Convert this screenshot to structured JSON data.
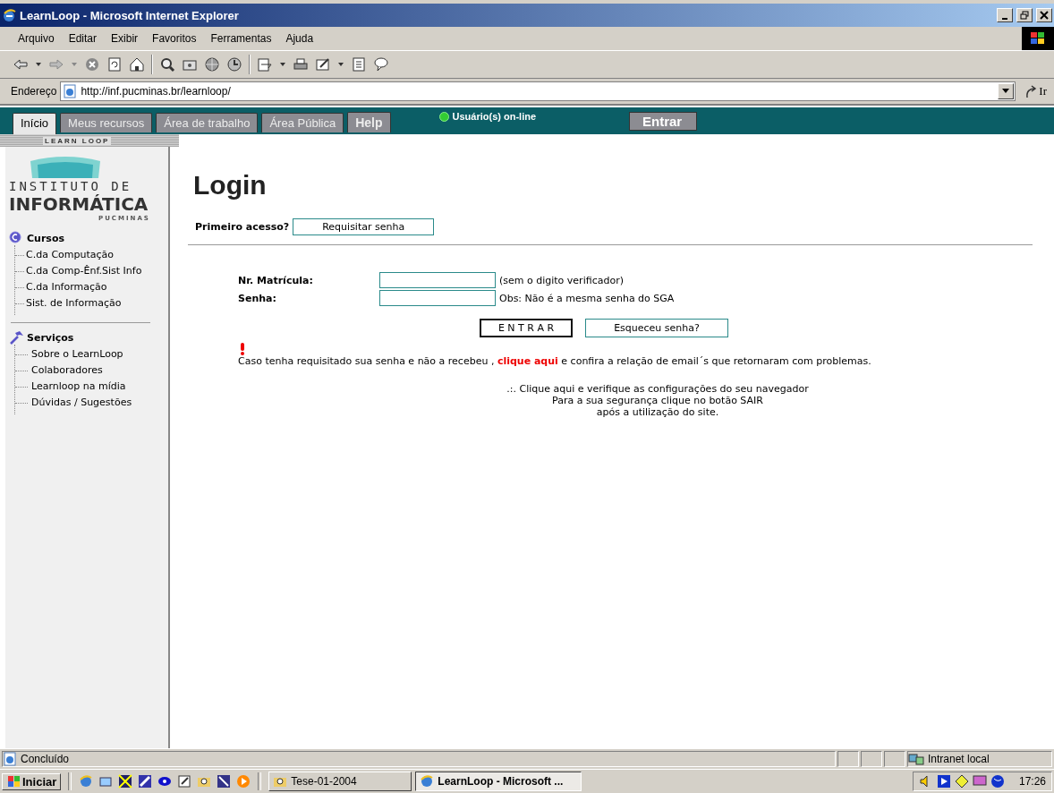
{
  "window": {
    "title": "LearnLoop - Microsoft Internet Explorer"
  },
  "menu": [
    "Arquivo",
    "Editar",
    "Exibir",
    "Favoritos",
    "Ferramentas",
    "Ajuda"
  ],
  "address": {
    "label": "Endereço",
    "url": "http://inf.pucminas.br/learnloop/",
    "go": "Ir"
  },
  "site_nav": {
    "tabs": [
      {
        "label": "Início",
        "selected": true
      },
      {
        "label": "Meus recursos",
        "selected": false
      },
      {
        "label": "Área de trabalho",
        "selected": false
      },
      {
        "label": "Área Pública",
        "selected": false
      },
      {
        "label": "Help",
        "selected": false
      }
    ],
    "online": "Usuário(s) on-line",
    "enter": "Entrar",
    "strip": "LEARN LOOP"
  },
  "sidebar": {
    "logo": [
      "INSTITUTO DE",
      "INFORMÁTICA",
      "PUCMINAS"
    ],
    "sections": [
      {
        "kind": "courses",
        "title": "Cursos",
        "items": [
          "C.da Computação",
          "C.da Comp-Ênf.Sist Info",
          "C.da Informação",
          "Sist. de Informação"
        ]
      },
      {
        "kind": "services",
        "title": "Serviços",
        "items": [
          "Sobre o LearnLoop",
          "Colaboradores",
          "Learnloop na mídia",
          "Dúvidas / Sugestões"
        ]
      }
    ]
  },
  "login": {
    "heading": "Login",
    "first_access": "Primeiro acesso?",
    "request": "Requisitar senha",
    "fields": [
      {
        "label": "Nr. Matrícula:",
        "note": "(sem o digito verificador)"
      },
      {
        "label": "Senha:",
        "note": "Obs: Não é a mesma senha do SGA"
      }
    ],
    "submit": "E N T R A R",
    "forgot": "Esqueceu senha?",
    "notice": {
      "before": "Caso tenha requisitado sua senha e não a recebeu ,",
      "link": "clique aqui",
      "after": "e confira a relação de email´s que retornaram com problemas."
    },
    "info": [
      ".:. Clique aqui e verifique as configurações do seu navegador",
      "Para a sua segurança clique no botão SAIR",
      "após a utilização do site."
    ]
  },
  "status_bar": {
    "text": "Concluído",
    "zone": "Intranet local"
  },
  "taskbar": {
    "start": "Iniciar",
    "tasks": [
      {
        "label": "Tese-01-2004",
        "selected": false
      },
      {
        "label": "LearnLoop - Microsoft ...",
        "selected": true
      }
    ],
    "clock": "17:26"
  }
}
